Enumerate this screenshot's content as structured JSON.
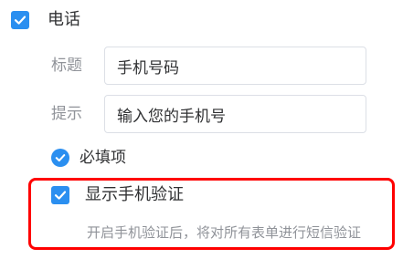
{
  "phone_field": {
    "checkbox_checked": true,
    "label": "电话"
  },
  "title_row": {
    "label": "标题",
    "value": "手机号码"
  },
  "hint_row": {
    "label": "提示",
    "value": "输入您的手机号"
  },
  "required": {
    "checked": true,
    "label": "必填项"
  },
  "verification": {
    "checked": true,
    "label": "显示手机验证",
    "description": "开启手机验证后，将对所有表单进行短信验证"
  },
  "colors": {
    "accent": "#2b8ff0",
    "highlight": "#ff0000",
    "label_gray": "#909399",
    "border_gray": "#dcdfe6"
  }
}
